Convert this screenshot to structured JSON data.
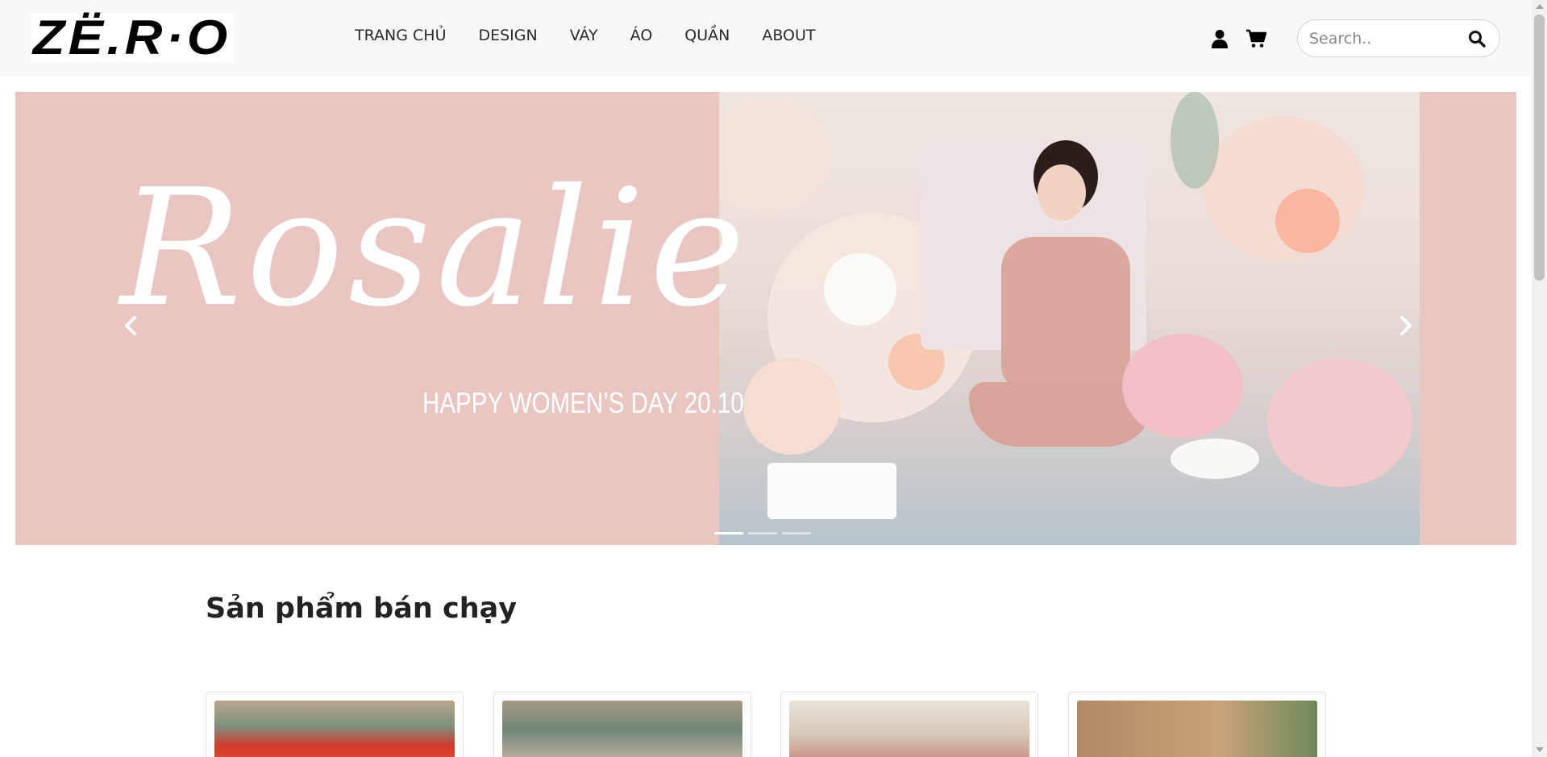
{
  "header": {
    "logo_text": "ZË.R·O",
    "nav": [
      {
        "label": "TRANG CHỦ"
      },
      {
        "label": "DESIGN"
      },
      {
        "label": "VÁY"
      },
      {
        "label": "ÁO"
      },
      {
        "label": "QUẦN"
      },
      {
        "label": "ABOUT"
      }
    ],
    "icons": [
      "user-icon",
      "cart-icon"
    ],
    "search": {
      "placeholder": "Search..",
      "value": ""
    }
  },
  "banner": {
    "script_title": "Rosalie",
    "subtitle": "HAPPY WOMEN’S DAY 20.10",
    "background_color": "#e9c6c2",
    "active_slide_index": 0,
    "slide_count": 3
  },
  "section": {
    "title": "Sản phẩm bán chạy",
    "card_count": 4
  },
  "colors": {
    "header_bg": "#f7f8fa",
    "banner_pink": "#e9c6c2",
    "text": "#222222"
  }
}
